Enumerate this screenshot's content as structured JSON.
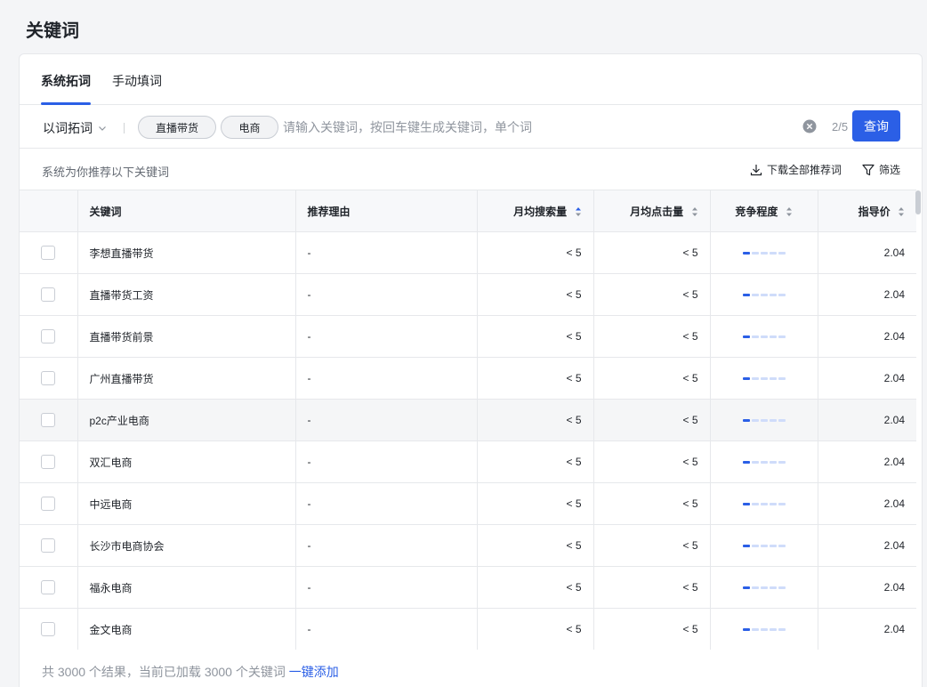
{
  "page": {
    "title": "关键词"
  },
  "tabs": [
    {
      "label": "系统拓词",
      "active": true
    },
    {
      "label": "手动填词",
      "active": false
    }
  ],
  "search": {
    "mode_label": "以词拓词",
    "tags": [
      "直播带货",
      "电商"
    ],
    "placeholder": "请输入关键词，按回车键生成关键词，单个词",
    "value": "",
    "count": "2/5",
    "query_label": "查询"
  },
  "hint": {
    "text": "系统为你推荐以下关键词",
    "download_label": "下载全部推荐词",
    "filter_label": "筛选"
  },
  "table": {
    "columns": [
      "关键词",
      "推荐理由",
      "月均搜索量",
      "月均点击量",
      "竞争程度",
      "指导价"
    ],
    "rows": [
      {
        "keyword": "李想直播带货",
        "reason": "-",
        "search": "< 5",
        "clicks": "< 5",
        "competition": 1,
        "price": "2.04"
      },
      {
        "keyword": "直播带货工资",
        "reason": "-",
        "search": "< 5",
        "clicks": "< 5",
        "competition": 1,
        "price": "2.04"
      },
      {
        "keyword": "直播带货前景",
        "reason": "-",
        "search": "< 5",
        "clicks": "< 5",
        "competition": 1,
        "price": "2.04"
      },
      {
        "keyword": "广州直播带货",
        "reason": "-",
        "search": "< 5",
        "clicks": "< 5",
        "competition": 1,
        "price": "2.04"
      },
      {
        "keyword": "p2c产业电商",
        "reason": "-",
        "search": "< 5",
        "clicks": "< 5",
        "competition": 1,
        "price": "2.04"
      },
      {
        "keyword": "双汇电商",
        "reason": "-",
        "search": "< 5",
        "clicks": "< 5",
        "competition": 1,
        "price": "2.04"
      },
      {
        "keyword": "中远电商",
        "reason": "-",
        "search": "< 5",
        "clicks": "< 5",
        "competition": 1,
        "price": "2.04"
      },
      {
        "keyword": "长沙市电商协会",
        "reason": "-",
        "search": "< 5",
        "clicks": "< 5",
        "competition": 1,
        "price": "2.04"
      },
      {
        "keyword": "福永电商",
        "reason": "-",
        "search": "< 5",
        "clicks": "< 5",
        "competition": 1,
        "price": "2.04"
      },
      {
        "keyword": "金文电商",
        "reason": "-",
        "search": "< 5",
        "clicks": "< 5",
        "competition": 1,
        "price": "2.04"
      }
    ],
    "competition_max": 5,
    "hovered_row": 4
  },
  "footer": {
    "summary": "共 3000 个结果，当前已加载 3000 个关键词",
    "add_all_label": "一键添加"
  },
  "colors": {
    "accent": "#2b5fe6",
    "competition_off": "#cfdcfa"
  }
}
